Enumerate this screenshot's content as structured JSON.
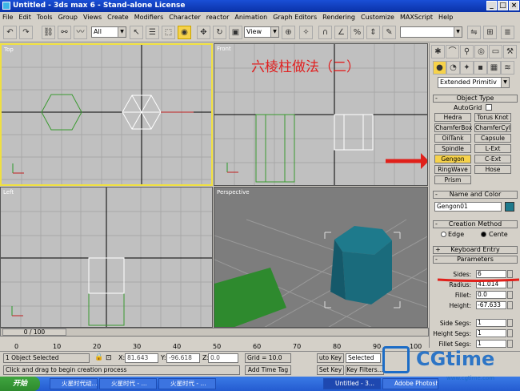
{
  "window": {
    "title": "Untitled - 3ds max 6 - Stand-alone License"
  },
  "menu": [
    "File",
    "Edit",
    "Tools",
    "Group",
    "Views",
    "Create",
    "Modifiers",
    "Character",
    "reactor",
    "Animation",
    "Graph Editors",
    "Rendering",
    "Customize",
    "MAXScript",
    "Help"
  ],
  "toolbar": {
    "selection_filter": "All",
    "ref_coord": "View"
  },
  "viewports": {
    "top": {
      "label": "Top"
    },
    "front": {
      "label": "Front",
      "annotation": "六棱柱做法（二）"
    },
    "left": {
      "label": "Left"
    },
    "perspective": {
      "label": "Perspective"
    }
  },
  "command_panel": {
    "category": "Extended Primitiv",
    "object_type": {
      "header": "Object Type",
      "autogrid": "AutoGrid",
      "buttons": [
        "Hedra",
        "Torus Knot",
        "ChamferBox",
        "ChamferCyl",
        "OilTank",
        "Capsule",
        "Spindle",
        "L-Ext",
        "Gengon",
        "C-Ext",
        "RingWave",
        "Hose",
        "Prism"
      ],
      "active": "Gengon"
    },
    "name_color": {
      "header": "Name and Color",
      "name": "Gengon01",
      "color": "#1e7a8c"
    },
    "creation_method": {
      "header": "Creation Method",
      "options": [
        "Edge",
        "Cente"
      ],
      "selected": "Cente"
    },
    "keyboard_entry": {
      "header": "Keyboard Entry"
    },
    "parameters": {
      "header": "Parameters",
      "fields": [
        {
          "label": "Sides:",
          "value": "6"
        },
        {
          "label": "Radius:",
          "value": "41.014"
        },
        {
          "label": "Fillet:",
          "value": "0.0"
        },
        {
          "label": "Height:",
          "value": "-67.633"
        },
        {
          "label": "Side Segs:",
          "value": "1"
        },
        {
          "label": "Height Segs:",
          "value": "1"
        },
        {
          "label": "Fillet Segs:",
          "value": "1"
        }
      ]
    }
  },
  "timeline": {
    "frame": "0 / 100",
    "ticks": [
      "0",
      "10",
      "20",
      "30",
      "40",
      "50",
      "60",
      "70",
      "80",
      "90",
      "100"
    ]
  },
  "status": {
    "selection": "1 Object Selected",
    "prompt": "Click and drag to begin creation process",
    "x_label": "X:",
    "x_value": "81.643",
    "y_label": "Y:",
    "y_value": "-96.618",
    "z_label": "Z:",
    "z_value": "0.0",
    "grid": "Grid = 10.0",
    "add_time_tag": "Add Time Tag",
    "auto_key": "uto Key",
    "set_key": "Set Key",
    "selected": "Selected",
    "key_filters": "Key Filters..."
  },
  "taskbar": {
    "start": "开始",
    "tasks": [
      "火星时代动...",
      "火星时代 - ...",
      "火星时代 - ...",
      "Untitled - 3...",
      "Adobe Photosho..."
    ],
    "active_index": 3
  },
  "watermark": {
    "text": "CGtime",
    "url": "www.cgtime.com"
  },
  "colors": {
    "accent_arrow": "#e0201a",
    "selected_viewport": "#f0e040",
    "active_button": "#f6d24a"
  }
}
